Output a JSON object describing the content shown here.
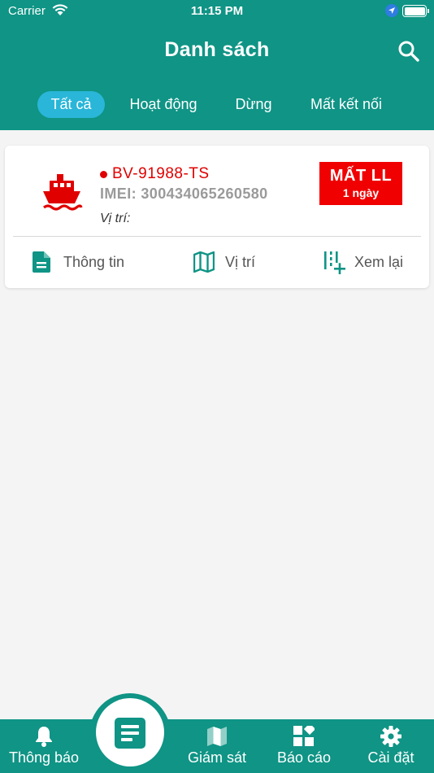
{
  "status_bar": {
    "carrier": "Carrier",
    "time": "11:15 PM"
  },
  "header": {
    "title": "Danh sách"
  },
  "tabs": [
    {
      "label": "Tất cả",
      "active": true
    },
    {
      "label": "Hoạt động",
      "active": false
    },
    {
      "label": "Dừng",
      "active": false
    },
    {
      "label": "Mất kết nối",
      "active": false
    }
  ],
  "vehicles": [
    {
      "plate": "BV-91988-TS",
      "imei": "IMEI: 300434065260580",
      "position_label": "Vị trí:",
      "status": "MẤT LL",
      "status_duration": "1 ngày",
      "actions": {
        "info": "Thông tin",
        "location": "Vị trí",
        "replay": "Xem lại"
      }
    }
  ],
  "bottom_nav": {
    "notifications": "Thông báo",
    "monitor": "Giám sát",
    "reports": "Báo cáo",
    "settings": "Cài đặt"
  },
  "colors": {
    "primary": "#0f9485",
    "active_tab": "#29b6d8",
    "alert": "#e00000",
    "background": "#f4f4f4"
  }
}
